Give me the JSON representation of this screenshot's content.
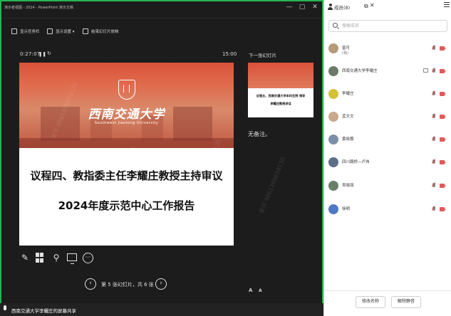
{
  "presenter": {
    "window_title": "演示者视图 - 2024 - PowerPoint 演示文稿",
    "toolbar": {
      "show_taskbar": "显示任务栏",
      "display_settings": "显示设置 ▾",
      "end_show": "结束幻灯片放映"
    },
    "timer": "0:27:07",
    "clock": "15:00",
    "slide": {
      "university_cn": "西南交通大学",
      "university_en": "Southwest Jiaotong University",
      "line1": "议程四、教指委主任李耀庄教授主持审议",
      "line2": "2024年度示范中心工作报告"
    },
    "navigator": "第 5 张幻灯片，共 6 张",
    "next_label": "下一张幻灯片",
    "next_slide": {
      "line1": "议程五、西南交通大学本科生院 领导",
      "line2": "李耀庄教授讲话"
    },
    "notes": "无备注。",
    "share_text": "西南交通大学李耀庄的屏幕共享"
  },
  "panel": {
    "title": "成员(8)",
    "search_placeholder": "搜索成员",
    "members": [
      {
        "name": "曾可",
        "sub": "(我)",
        "avatar_color": "#b79a7a"
      },
      {
        "name": "西南交通大学李耀庄",
        "sub": "",
        "avatar_color": "#6b7a6a"
      },
      {
        "name": "李耀庄",
        "sub": "",
        "avatar_color": "#d6c23a"
      },
      {
        "name": "孟文文",
        "sub": "",
        "avatar_color": "#c9a88c"
      },
      {
        "name": "黄晓蓉",
        "sub": "",
        "avatar_color": "#7d8fa8"
      },
      {
        "name": "四川路桥—卢伟",
        "sub": "",
        "avatar_color": "#5b6f88"
      },
      {
        "name": "吴晓丽",
        "sub": "",
        "avatar_color": "#6a7f6a"
      },
      {
        "name": "徐明",
        "sub": "",
        "avatar_color": "#4e79c4"
      }
    ],
    "rename_button": "修改名称",
    "unmute_button": "解除静音"
  },
  "watermark": "曾可 4861389658130",
  "colors": {
    "frame_green": "#26b552",
    "slide_red": "#d9523a"
  }
}
